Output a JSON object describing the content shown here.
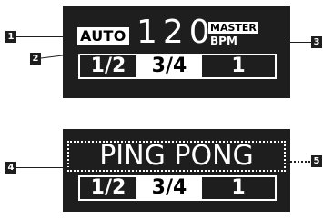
{
  "display_top": {
    "auto_label": "AUTO",
    "bpm_value": "120",
    "master_label": "MASTER",
    "bpm_unit": "BPM",
    "loop_options": [
      "1/2",
      "3/4",
      "1"
    ],
    "selected_index": 1
  },
  "display_bottom": {
    "mode_text": "PING PONG",
    "loop_options": [
      "1/2",
      "3/4",
      "1"
    ],
    "selected_index": 1
  },
  "callouts": [
    "1",
    "2",
    "3",
    "4",
    "5"
  ],
  "colors": {
    "panel": "#1e1e1e",
    "foreground": "#ffffff"
  }
}
